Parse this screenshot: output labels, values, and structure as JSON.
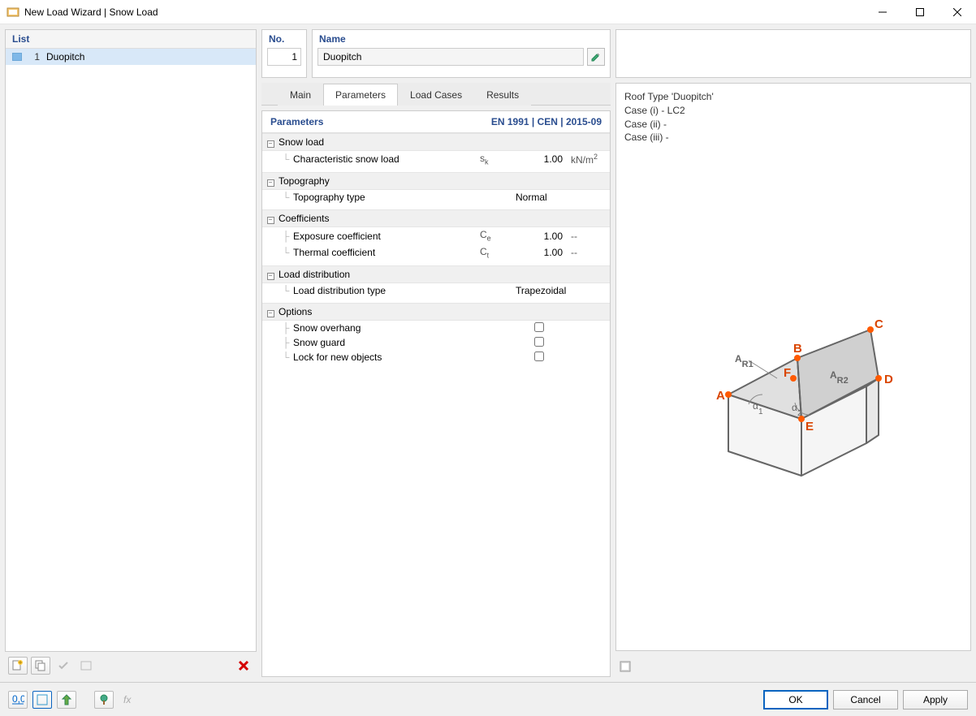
{
  "window": {
    "title": "New Load Wizard | Snow Load"
  },
  "list": {
    "header": "List",
    "items": [
      {
        "num": "1",
        "name": "Duopitch"
      }
    ]
  },
  "header_fields": {
    "no_label": "No.",
    "no_value": "1",
    "name_label": "Name",
    "name_value": "Duopitch"
  },
  "tabs": {
    "main": "Main",
    "parameters": "Parameters",
    "load_cases": "Load Cases",
    "results": "Results"
  },
  "param_header": {
    "left": "Parameters",
    "right": "EN 1991 | CEN | 2015-09"
  },
  "groups": {
    "snow_load": {
      "title": "Snow load",
      "rows": [
        {
          "name": "Characteristic snow load",
          "sym": "s",
          "sub": "k",
          "val": "1.00",
          "unit": "kN/m",
          "sup": "2"
        }
      ]
    },
    "topography": {
      "title": "Topography",
      "rows": [
        {
          "name": "Topography type",
          "txt": "Normal"
        }
      ]
    },
    "coefficients": {
      "title": "Coefficients",
      "rows": [
        {
          "name": "Exposure coefficient",
          "sym": "C",
          "sub": "e",
          "val": "1.00",
          "unit": "--"
        },
        {
          "name": "Thermal coefficient",
          "sym": "C",
          "sub": "t",
          "val": "1.00",
          "unit": "--"
        }
      ]
    },
    "load_dist": {
      "title": "Load distribution",
      "rows": [
        {
          "name": "Load distribution type",
          "txt": "Trapezoidal"
        }
      ]
    },
    "options": {
      "title": "Options",
      "rows": [
        {
          "name": "Snow overhang"
        },
        {
          "name": "Snow guard"
        },
        {
          "name": "Lock for new objects"
        }
      ]
    }
  },
  "info": {
    "line1": "Roof Type 'Duopitch'",
    "line2": "Case (i) - LC2",
    "line3": "Case (ii) -",
    "line4": "Case (iii) -"
  },
  "diagram_labels": {
    "A": "A",
    "B": "B",
    "C": "C",
    "D": "D",
    "E": "E",
    "F": "F",
    "AR1": "A",
    "AR1s": "R1",
    "AR2": "A",
    "AR2s": "R2",
    "a1": "α",
    "a1s": "1",
    "a2": "α",
    "a2s": "2"
  },
  "buttons": {
    "ok": "OK",
    "cancel": "Cancel",
    "apply": "Apply"
  }
}
